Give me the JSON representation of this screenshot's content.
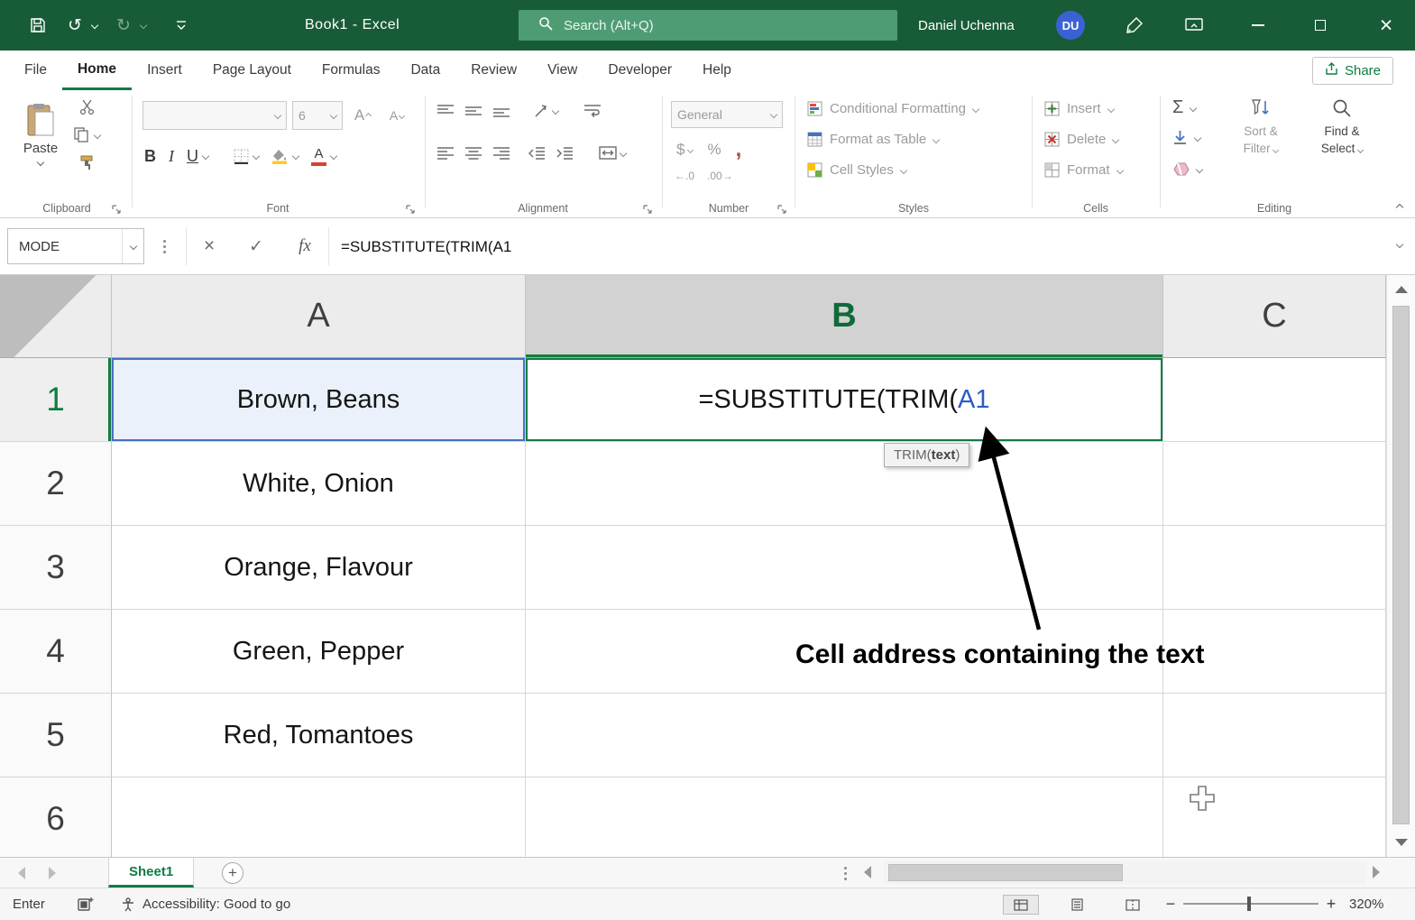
{
  "colors": {
    "titlebar_green": "#185C37",
    "accent_green": "#107C41",
    "search_green": "#4E9C74",
    "avatar_blue": "#3B62D3",
    "reference_blue": "#2B5BC9",
    "selection_blue": "#4472C4"
  },
  "titlebar": {
    "title": "Book1 - Excel",
    "search_placeholder": "Search (Alt+Q)",
    "user_name": "Daniel Uchenna",
    "user_initials": "DU"
  },
  "tabs": {
    "items": [
      "File",
      "Home",
      "Insert",
      "Page Layout",
      "Formulas",
      "Data",
      "Review",
      "View",
      "Developer",
      "Help"
    ],
    "active": "Home",
    "share": "Share"
  },
  "ribbon": {
    "clipboard": {
      "label": "Clipboard",
      "paste": "Paste"
    },
    "font": {
      "label": "Font",
      "size": "6",
      "bold": "B",
      "italic": "I",
      "underline": "U",
      "grow": "A",
      "shrink": "A",
      "color_letter": "A"
    },
    "alignment": {
      "label": "Alignment"
    },
    "number": {
      "label": "Number",
      "format": "General",
      "currency": "$",
      "percent": "%",
      "comma": ",",
      "inc_decimal": "←.0",
      "dec_decimal": ".00→"
    },
    "styles": {
      "label": "Styles",
      "conditional": "Conditional Formatting",
      "format_table": "Format as Table",
      "cell_styles": "Cell Styles"
    },
    "cells": {
      "label": "Cells",
      "insert": "Insert",
      "delete": "Delete",
      "format": "Format"
    },
    "editing": {
      "label": "Editing",
      "autosum": "Σ",
      "sort_line1": "Sort &",
      "sort_line2": "Filter",
      "find_line1": "Find &",
      "find_line2": "Select"
    }
  },
  "formula_bar": {
    "name_box": "MODE",
    "cancel": "×",
    "enter": "✓",
    "fx": "fx",
    "formula": "=SUBSTITUTE(TRIM(A1"
  },
  "sheet": {
    "columns": [
      "A",
      "B",
      "C"
    ],
    "rows": [
      "1",
      "2",
      "3",
      "4",
      "5",
      "6"
    ],
    "a_values": [
      "Brown, Beans",
      "White, Onion",
      "Orange, Flavour",
      "Green, Pepper",
      "Red, Tomantoes"
    ],
    "b1": {
      "prefix": "=SUBSTITUTE(TRIM(",
      "ref": "A1"
    },
    "tooltip": {
      "prefix": "TRIM(",
      "bold": "text",
      "suffix": ")"
    },
    "annotation": "Cell address containing the text"
  },
  "sheet_tabs": {
    "active": "Sheet1",
    "add": "+"
  },
  "status_bar": {
    "mode": "Enter",
    "accessibility": "Accessibility: Good to go",
    "zoom": "320%",
    "minus": "−",
    "plus": "+"
  }
}
